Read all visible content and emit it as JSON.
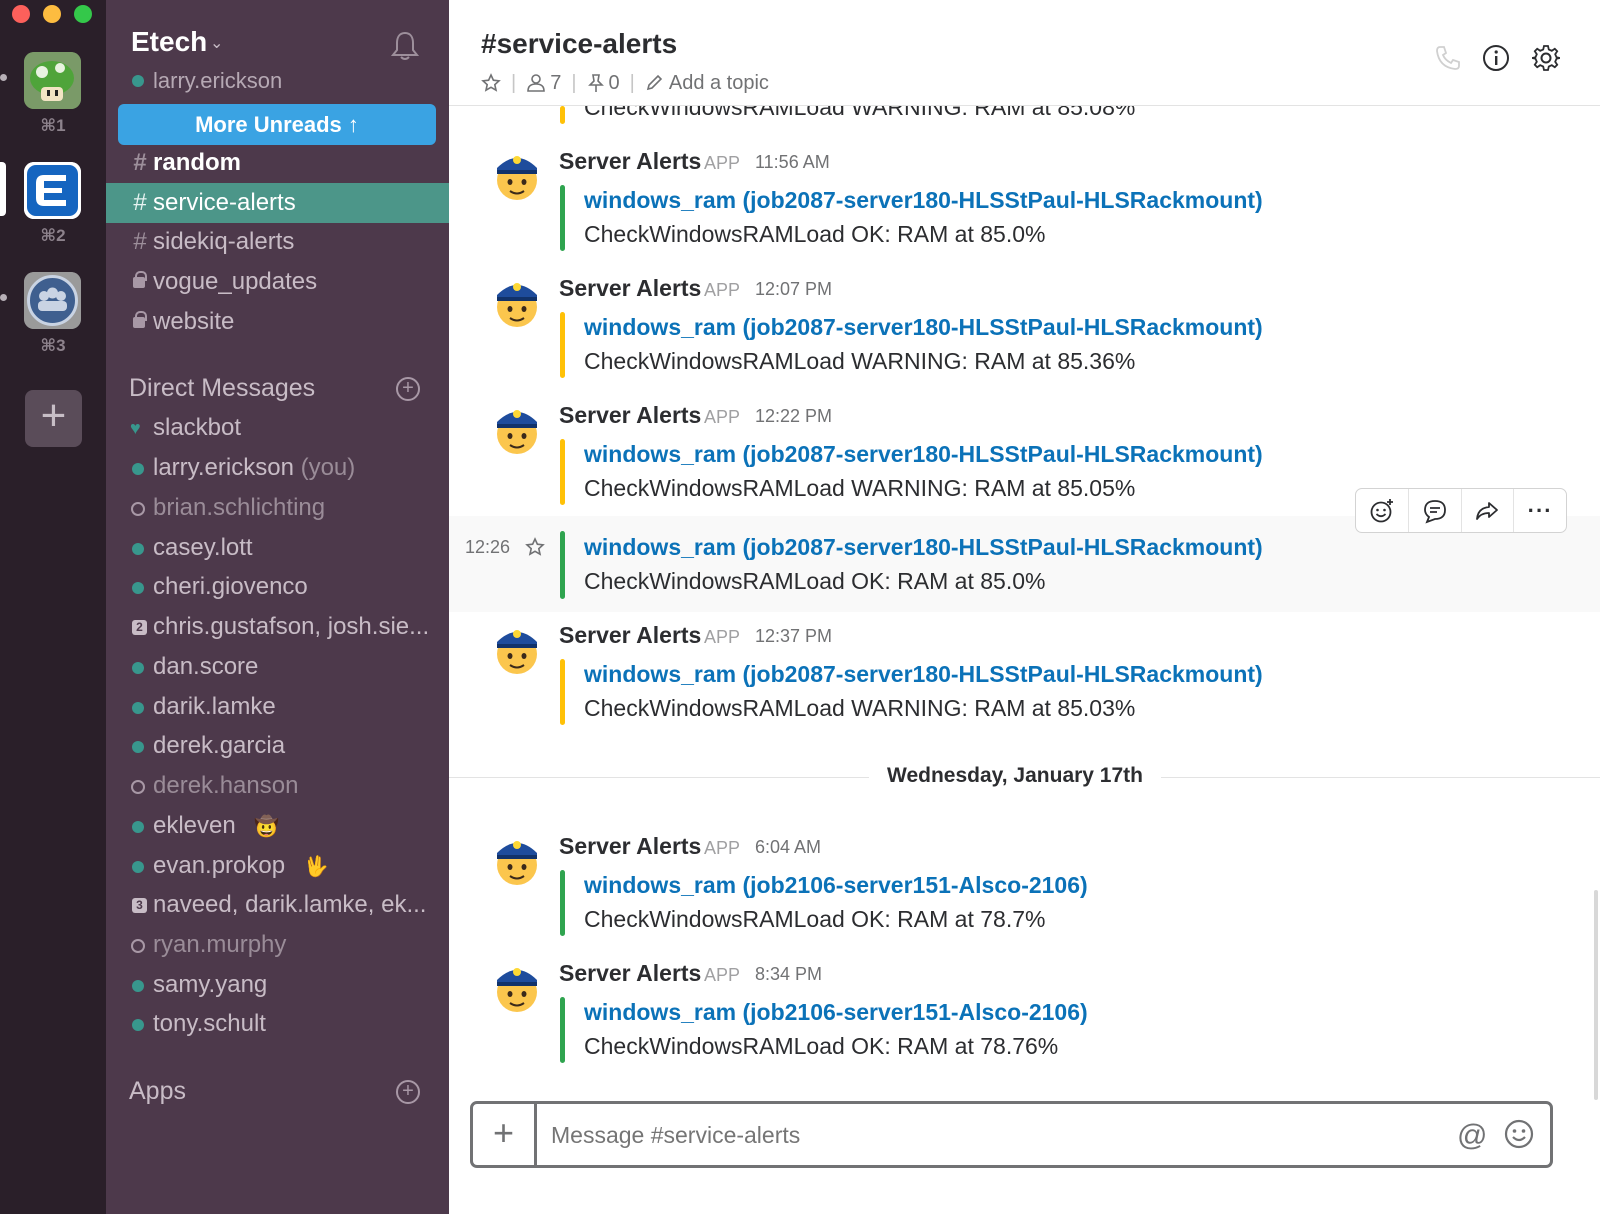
{
  "window": {
    "traffic_lights": [
      "#fc605b",
      "#fdbc40",
      "#34c84a"
    ]
  },
  "teams": [
    {
      "key": "⌘1",
      "icon": "mushroom-icon"
    },
    {
      "key": "⌘2",
      "icon": "etech-logo-icon"
    },
    {
      "key": "⌘3",
      "icon": "team-247-icon"
    }
  ],
  "sidebar": {
    "team_name": "Etech",
    "user_name": "larry.erickson",
    "more_unreads": "More Unreads",
    "channels": [
      {
        "prefix": "#",
        "label": "random"
      },
      {
        "prefix": "#",
        "label": "service-alerts"
      },
      {
        "prefix": "#",
        "label": "sidekiq-alerts"
      },
      {
        "prefix": "lock",
        "label": "vogue_updates"
      },
      {
        "prefix": "lock",
        "label": "website"
      }
    ],
    "direct_messages_title": "Direct Messages",
    "direct_messages": [
      {
        "label": "slackbot"
      },
      {
        "label": "larry.erickson",
        "suffix": "(you)"
      },
      {
        "label": "brian.schlichting"
      },
      {
        "label": "casey.lott"
      },
      {
        "label": "cheri.giovenco"
      },
      {
        "label": "chris.gustafson, josh.sie...",
        "count": "2"
      },
      {
        "label": "dan.score"
      },
      {
        "label": "darik.lamke"
      },
      {
        "label": "derek.garcia"
      },
      {
        "label": "derek.hanson"
      },
      {
        "label": "ekleven"
      },
      {
        "label": "evan.prokop"
      },
      {
        "label": "naveed, darik.lamke, ek...",
        "count": "3"
      },
      {
        "label": "ryan.murphy"
      },
      {
        "label": "samy.yang"
      },
      {
        "label": "tony.schult"
      }
    ],
    "apps_title": "Apps"
  },
  "header": {
    "channel": "#service-alerts",
    "members": "7",
    "pins": "0",
    "topic_placeholder": "Add a topic"
  },
  "messages": [
    {
      "sender": "Server Alerts",
      "tag": "APP",
      "time": "11:56 AM",
      "link": "windows_ram (job2087-server180-HLSStPaul-HLSRackmount)",
      "text": "CheckWindowsRAMLoad OK: RAM at 85.0%",
      "status": "ok"
    },
    {
      "sender": "Server Alerts",
      "tag": "APP",
      "time": "12:07 PM",
      "link": "windows_ram (job2087-server180-HLSStPaul-HLSRackmount)",
      "text": "CheckWindowsRAMLoad WARNING: RAM at 85.36%",
      "status": "warning"
    },
    {
      "sender": "Server Alerts",
      "tag": "APP",
      "time": "12:22 PM",
      "link": "windows_ram (job2087-server180-HLSStPaul-HLSRackmount)",
      "text": "CheckWindowsRAMLoad WARNING: RAM at 85.05%",
      "status": "warning"
    },
    {
      "time": "12:26",
      "link": "windows_ram (job2087-server180-HLSStPaul-HLSRackmount)",
      "text": "CheckWindowsRAMLoad OK: RAM at 85.0%",
      "status": "ok"
    },
    {
      "sender": "Server Alerts",
      "tag": "APP",
      "time": "12:37 PM",
      "link": "windows_ram (job2087-server180-HLSStPaul-HLSRackmount)",
      "text": "CheckWindowsRAMLoad WARNING: RAM at 85.03%",
      "status": "warning"
    },
    {
      "sender": "Server Alerts",
      "tag": "APP",
      "time": "6:04 AM",
      "link": "windows_ram (job2106-server151-Alsco-2106)",
      "text": "CheckWindowsRAMLoad OK: RAM at 78.7%",
      "status": "ok"
    },
    {
      "sender": "Server Alerts",
      "tag": "APP",
      "time": "8:34 PM",
      "link": "windows_ram (job2106-server151-Alsco-2106)",
      "text": "CheckWindowsRAMLoad OK: RAM at 78.76%",
      "status": "ok"
    }
  ],
  "partial_top_text": "CheckWindowsRAMLoad WARNING: RAM at 85.08%",
  "day_divider": "Wednesday, January 17th",
  "composer": {
    "placeholder": "Message #service-alerts"
  },
  "colors": {
    "ok": "#2fa44f",
    "warning": "#ffc107",
    "sidebar": "#4d394b",
    "active_channel": "#4c9689",
    "link": "#0b72b8"
  }
}
